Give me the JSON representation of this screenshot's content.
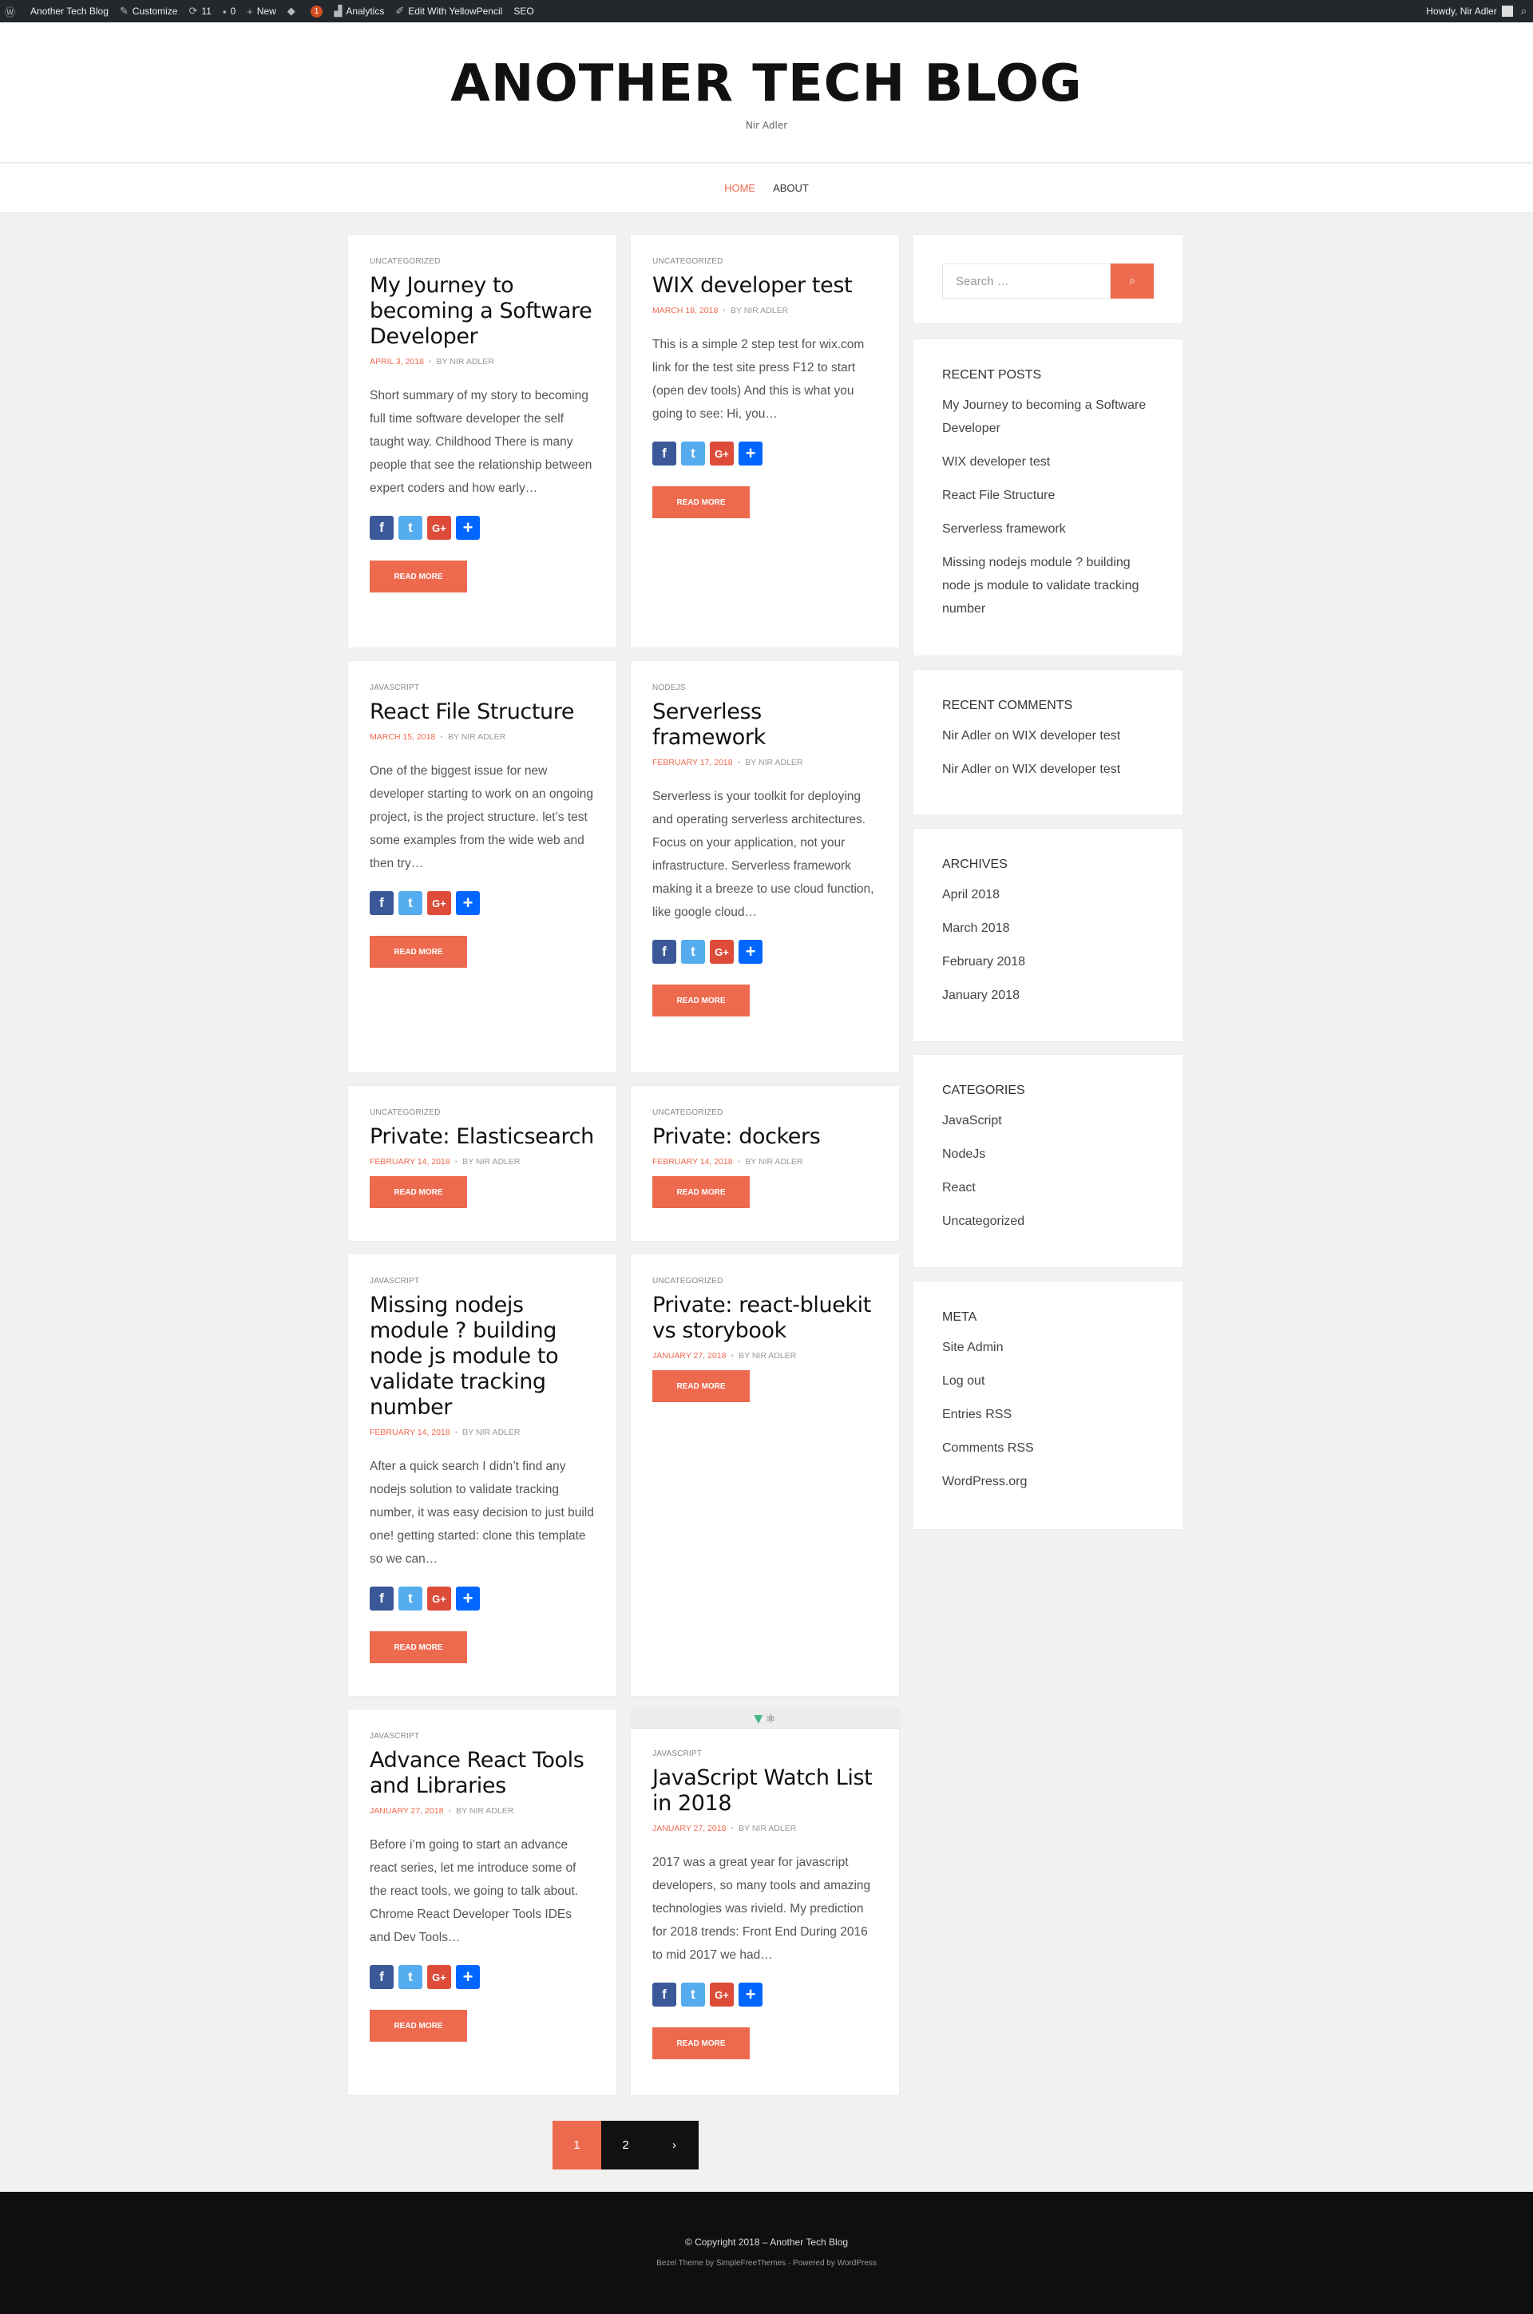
{
  "adminbar": {
    "site": "Another Tech Blog",
    "customize": "Customize",
    "updates": "11",
    "comments": "0",
    "new": "New",
    "badge": "1",
    "analytics": "Analytics",
    "yellowpencil": "Edit With YellowPencil",
    "seo": "SEO",
    "howdy": "Howdy, Nir Adler"
  },
  "header": {
    "title": "ANOTHER TECH BLOG",
    "tagline": "Nir Adler"
  },
  "nav": {
    "home": "HOME",
    "about": "ABOUT"
  },
  "posts": [
    {
      "cat": "UNCATEGORIZED",
      "title": "My Journey to becoming a Software Developer",
      "date": "APRIL 3, 2018",
      "by": "BY NIR ADLER",
      "excerpt": "Short summary of my story to becoming full time software developer the self taught way. Childhood There is many people that see the relationship between expert coders and how early…",
      "read": "READ MORE"
    },
    {
      "cat": "UNCATEGORIZED",
      "title": "WIX developer test",
      "date": "MARCH 18, 2018",
      "by": "BY NIR ADLER",
      "excerpt": "This is a simple 2 step test for wix.com link for the test site press F12 to start (open dev tools) And this is what you going to see: Hi, you…",
      "read": "READ MORE"
    },
    {
      "cat": "JAVASCRIPT",
      "title": "React File Structure",
      "date": "MARCH 15, 2018",
      "by": "BY NIR ADLER",
      "excerpt": "One of the biggest issue for new developer starting to work on an ongoing project, is the project structure. let’s test some examples from the wide web and then try…",
      "read": "READ MORE"
    },
    {
      "cat": "NODEJS",
      "title": "Serverless framework",
      "date": "FEBRUARY 17, 2018",
      "by": "BY NIR ADLER",
      "excerpt": "Serverless is your toolkit for deploying and operating serverless architectures. Focus on your application, not your infrastructure. Serverless framework making it a breeze to use cloud function, like google cloud…",
      "read": "READ MORE"
    },
    {
      "cat": "UNCATEGORIZED",
      "title": "Private: Elasticsearch",
      "date": "FEBRUARY 14, 2018",
      "by": "BY NIR ADLER",
      "read": "READ MORE"
    },
    {
      "cat": "UNCATEGORIZED",
      "title": "Private: dockers",
      "date": "FEBRUARY 14, 2018",
      "by": "BY NIR ADLER",
      "read": "READ MORE"
    },
    {
      "cat": "JAVASCRIPT",
      "title": "Missing nodejs module ? building node js module to validate tracking number",
      "date": "FEBRUARY 14, 2018",
      "by": "BY NIR ADLER",
      "excerpt": "After a quick search I didn’t find any nodejs solution to validate tracking number, it was easy decision to just build one! getting started: clone this template so we can…",
      "read": "READ MORE"
    },
    {
      "cat": "UNCATEGORIZED",
      "title": "Private: react-bluekit vs storybook",
      "date": "JANUARY 27, 2018",
      "by": "BY NIR ADLER",
      "read": "READ MORE"
    },
    {
      "cat": "JAVASCRIPT",
      "title": "Advance React Tools and Libraries",
      "date": "JANUARY 27, 2018",
      "by": "BY NIR ADLER",
      "excerpt": "Before i’m going to start an advance react series, let me introduce some of the react tools, we going to talk about. Chrome React Developer Tools IDEs and Dev Tools…",
      "read": "READ MORE"
    },
    {
      "cat": "JAVASCRIPT",
      "title": "JavaScript Watch List in 2018",
      "date": "JANUARY 27, 2018",
      "by": "BY NIR ADLER",
      "excerpt": "2017 was a great year for javascript developers, so many tools and amazing technologies was rivield. My prediction for 2018 trends: Front End During 2016 to mid 2017 we had…",
      "read": "READ MORE"
    }
  ],
  "share": {
    "fb": "f",
    "tw": "t",
    "gp": "G+",
    "sh": "+"
  },
  "sidebar": {
    "search_placeholder": "Search …",
    "recent_posts_title": "RECENT POSTS",
    "recent_posts": [
      "My Journey to becoming a Software Developer",
      "WIX developer test",
      "React File Structure",
      "Serverless framework",
      "Missing nodejs module ? building node js module to validate tracking number"
    ],
    "recent_comments_title": "RECENT COMMENTS",
    "recent_comments": [
      "Nir Adler on WIX developer test",
      "Nir Adler on WIX developer test"
    ],
    "archives_title": "ARCHIVES",
    "archives": [
      "April 2018",
      "March 2018",
      "February 2018",
      "January 2018"
    ],
    "categories_title": "CATEGORIES",
    "categories": [
      "JavaScript",
      "NodeJs",
      "React",
      "Uncategorized"
    ],
    "meta_title": "META",
    "meta": [
      "Site Admin",
      "Log out",
      "Entries RSS",
      "Comments RSS",
      "WordPress.org"
    ]
  },
  "pagination": {
    "current": "1",
    "next_page": "2",
    "next": "›"
  },
  "footer": {
    "copyright": "© Copyright 2018 – Another Tech Blog",
    "credits": "Bezel Theme by SimpleFreeThemes · Powered by WordPress"
  },
  "colors": {
    "accent": "#ee6a4f",
    "adminbar": "#23282d",
    "footer": "#0f0f0f"
  }
}
